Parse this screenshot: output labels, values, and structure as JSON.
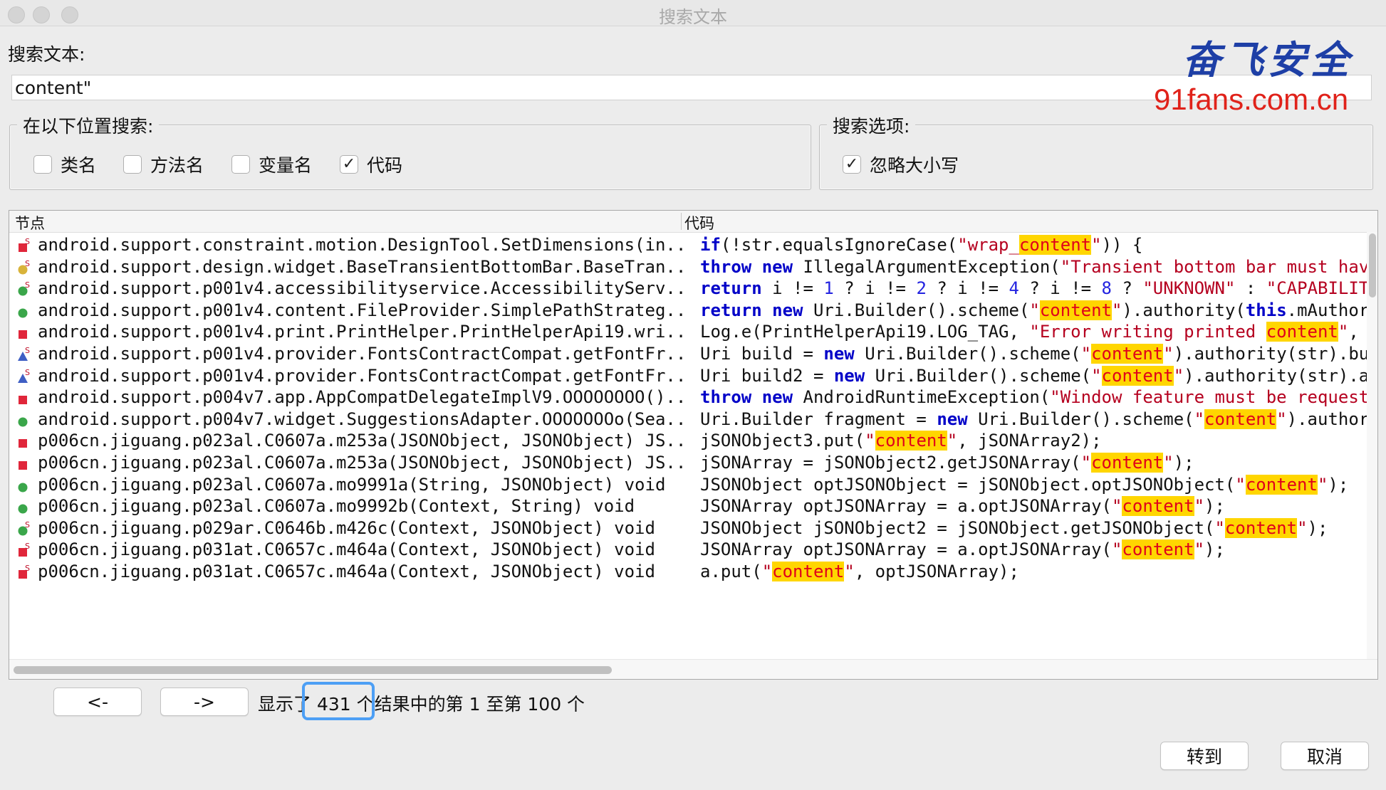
{
  "window": {
    "title": "搜索文本"
  },
  "search": {
    "label": "搜索文本:",
    "value": "content\""
  },
  "watermark": {
    "brand": "奋飞安全",
    "url": "91fans.com.cn"
  },
  "location_group": {
    "title": "在以下位置搜索:",
    "options": [
      {
        "label": "类名",
        "checked": false
      },
      {
        "label": "方法名",
        "checked": false
      },
      {
        "label": "变量名",
        "checked": false
      },
      {
        "label": "代码",
        "checked": true
      }
    ]
  },
  "options_group": {
    "title": "搜索选项:",
    "options": [
      {
        "label": "忽略大小写",
        "checked": true
      }
    ]
  },
  "checkmark": "✓",
  "table": {
    "headers": {
      "node": "节点",
      "code": "代码"
    },
    "rows": [
      {
        "icon": "method-static-red",
        "node": "android.support.constraint.motion.DesignTool.SetDimensions(in...",
        "code": [
          [
            "kw",
            "if"
          ],
          [
            "",
            "("
          ],
          [
            "",
            "!str.equalsIgnoreCase("
          ],
          [
            "st",
            "\"wrap_"
          ],
          [
            "hl",
            "content"
          ],
          [
            "st",
            "\""
          ],
          [
            "",
            "))"
          ],
          [
            "",
            " {"
          ]
        ]
      },
      {
        "icon": "method-static-yellow",
        "node": "android.support.design.widget.BaseTransientBottomBar.BaseTran...",
        "code": [
          [
            "kw",
            "throw"
          ],
          [
            "",
            " "
          ],
          [
            "kw",
            "new"
          ],
          [
            "",
            " IllegalArgumentException("
          ],
          [
            "st",
            "\"Transient bottom bar must have"
          ]
        ]
      },
      {
        "icon": "method-static-green",
        "node": "android.support.p001v4.accessibilityservice.AccessibilityServ...",
        "code": [
          [
            "kw",
            "return"
          ],
          [
            "",
            " i != "
          ],
          [
            "num",
            "1"
          ],
          [
            "",
            " ? i != "
          ],
          [
            "num",
            "2"
          ],
          [
            "",
            " ? i != "
          ],
          [
            "num",
            "4"
          ],
          [
            "",
            " ? i != "
          ],
          [
            "num",
            "8"
          ],
          [
            "",
            " ? "
          ],
          [
            "st",
            "\"UNKNOWN\""
          ],
          [
            "",
            " : "
          ],
          [
            "st",
            "\"CAPABILITY"
          ]
        ]
      },
      {
        "icon": "method-green",
        "node": "android.support.p001v4.content.FileProvider.SimplePathStrateg...",
        "code": [
          [
            "kw",
            "return"
          ],
          [
            "",
            " "
          ],
          [
            "kw",
            "new"
          ],
          [
            "",
            " Uri.Builder().scheme("
          ],
          [
            "st",
            "\""
          ],
          [
            "hl",
            "content"
          ],
          [
            "st",
            "\""
          ],
          [
            "",
            ").authority("
          ],
          [
            "kw",
            "this"
          ],
          [
            "",
            ".mAuthori"
          ]
        ]
      },
      {
        "icon": "method-red",
        "node": "android.support.p001v4.print.PrintHelper.PrintHelperApi19.wri...",
        "code": [
          [
            "",
            "Log.e(PrintHelperApi19.LOG_TAG, "
          ],
          [
            "st",
            "\"Error writing printed "
          ],
          [
            "hl",
            "content"
          ],
          [
            "st",
            "\""
          ],
          [
            "",
            ", t"
          ]
        ]
      },
      {
        "icon": "method-static-blue",
        "node": "android.support.p001v4.provider.FontsContractCompat.getFontFr...",
        "code": [
          [
            "",
            "Uri build = "
          ],
          [
            "kw",
            "new"
          ],
          [
            "",
            " Uri.Builder().scheme("
          ],
          [
            "st",
            "\""
          ],
          [
            "hl",
            "content"
          ],
          [
            "st",
            "\""
          ],
          [
            "",
            ").authority(str).bui"
          ]
        ]
      },
      {
        "icon": "method-static-blue",
        "node": "android.support.p001v4.provider.FontsContractCompat.getFontFr...",
        "code": [
          [
            "",
            "Uri build2 = "
          ],
          [
            "kw",
            "new"
          ],
          [
            "",
            " Uri.Builder().scheme("
          ],
          [
            "st",
            "\""
          ],
          [
            "hl",
            "content"
          ],
          [
            "st",
            "\""
          ],
          [
            "",
            ").authority(str).ap"
          ]
        ]
      },
      {
        "icon": "method-red",
        "node": "android.support.p004v7.app.AppCompatDelegateImplV9.OOOOOOOO()...",
        "code": [
          [
            "kw",
            "throw"
          ],
          [
            "",
            " "
          ],
          [
            "kw",
            "new"
          ],
          [
            "",
            " AndroidRuntimeException("
          ],
          [
            "st",
            "\"Window feature must be requeste"
          ]
        ]
      },
      {
        "icon": "method-green",
        "node": "android.support.p004v7.widget.SuggestionsAdapter.OOOOOOOo(Sea...",
        "code": [
          [
            "",
            "Uri.Builder fragment = "
          ],
          [
            "kw",
            "new"
          ],
          [
            "",
            " Uri.Builder().scheme("
          ],
          [
            "st",
            "\""
          ],
          [
            "hl",
            "content"
          ],
          [
            "st",
            "\""
          ],
          [
            "",
            ").authori"
          ]
        ]
      },
      {
        "icon": "method-red",
        "node": "p006cn.jiguang.p023al.C0607a.m253a(JSONObject, JSONObject) JS...",
        "code": [
          [
            "",
            "jSONObject3.put("
          ],
          [
            "st",
            "\""
          ],
          [
            "hl",
            "content"
          ],
          [
            "st",
            "\""
          ],
          [
            "",
            ", jSONArray2);"
          ]
        ]
      },
      {
        "icon": "method-red",
        "node": "p006cn.jiguang.p023al.C0607a.m253a(JSONObject, JSONObject) JS...",
        "code": [
          [
            "",
            "jSONArray = jSONObject2.getJSONArray("
          ],
          [
            "st",
            "\""
          ],
          [
            "hl",
            "content"
          ],
          [
            "st",
            "\""
          ],
          [
            "",
            ");"
          ]
        ]
      },
      {
        "icon": "method-green",
        "node": "p006cn.jiguang.p023al.C0607a.mo9991a(String, JSONObject) void",
        "code": [
          [
            "",
            "JSONObject optJSONObject = jSONObject.optJSONObject("
          ],
          [
            "st",
            "\""
          ],
          [
            "hl",
            "content"
          ],
          [
            "st",
            "\""
          ],
          [
            "",
            ");"
          ]
        ]
      },
      {
        "icon": "method-green",
        "node": "p006cn.jiguang.p023al.C0607a.mo9992b(Context, String) void",
        "code": [
          [
            "",
            "JSONArray optJSONArray = a.optJSONArray("
          ],
          [
            "st",
            "\""
          ],
          [
            "hl",
            "content"
          ],
          [
            "st",
            "\""
          ],
          [
            "",
            ");"
          ]
        ]
      },
      {
        "icon": "method-static-green",
        "node": "p006cn.jiguang.p029ar.C0646b.m426c(Context, JSONObject) void",
        "code": [
          [
            "",
            "JSONObject jSONObject2 = jSONObject.getJSONObject("
          ],
          [
            "st",
            "\""
          ],
          [
            "hl",
            "content"
          ],
          [
            "st",
            "\""
          ],
          [
            "",
            ");"
          ]
        ]
      },
      {
        "icon": "method-static-red",
        "node": "p006cn.jiguang.p031at.C0657c.m464a(Context, JSONObject) void",
        "code": [
          [
            "",
            "JSONArray optJSONArray = a.optJSONArray("
          ],
          [
            "st",
            "\""
          ],
          [
            "hl",
            "content"
          ],
          [
            "st",
            "\""
          ],
          [
            "",
            ");"
          ]
        ]
      },
      {
        "icon": "method-static-red",
        "node": "p006cn.jiguang.p031at.C0657c.m464a(Context, JSONObject) void",
        "code": [
          [
            "",
            "a.put("
          ],
          [
            "st",
            "\""
          ],
          [
            "hl",
            "content"
          ],
          [
            "st",
            "\""
          ],
          [
            "",
            ", optJSONArray);"
          ]
        ]
      }
    ]
  },
  "pager": {
    "prev": "<-",
    "next": "->",
    "status_prefix": "显示了",
    "total": "431",
    "status_suffix": "个结果中的第 1 至第 100 个"
  },
  "actions": {
    "goto": "转到",
    "cancel": "取消"
  },
  "colors": {
    "icon_red": "#e0263a",
    "icon_green": "#3aa64a",
    "icon_blue": "#3f5fc4",
    "icon_yellow": "#d8b33a",
    "highlight": "#ffd600",
    "focus": "#4d9ff5"
  }
}
